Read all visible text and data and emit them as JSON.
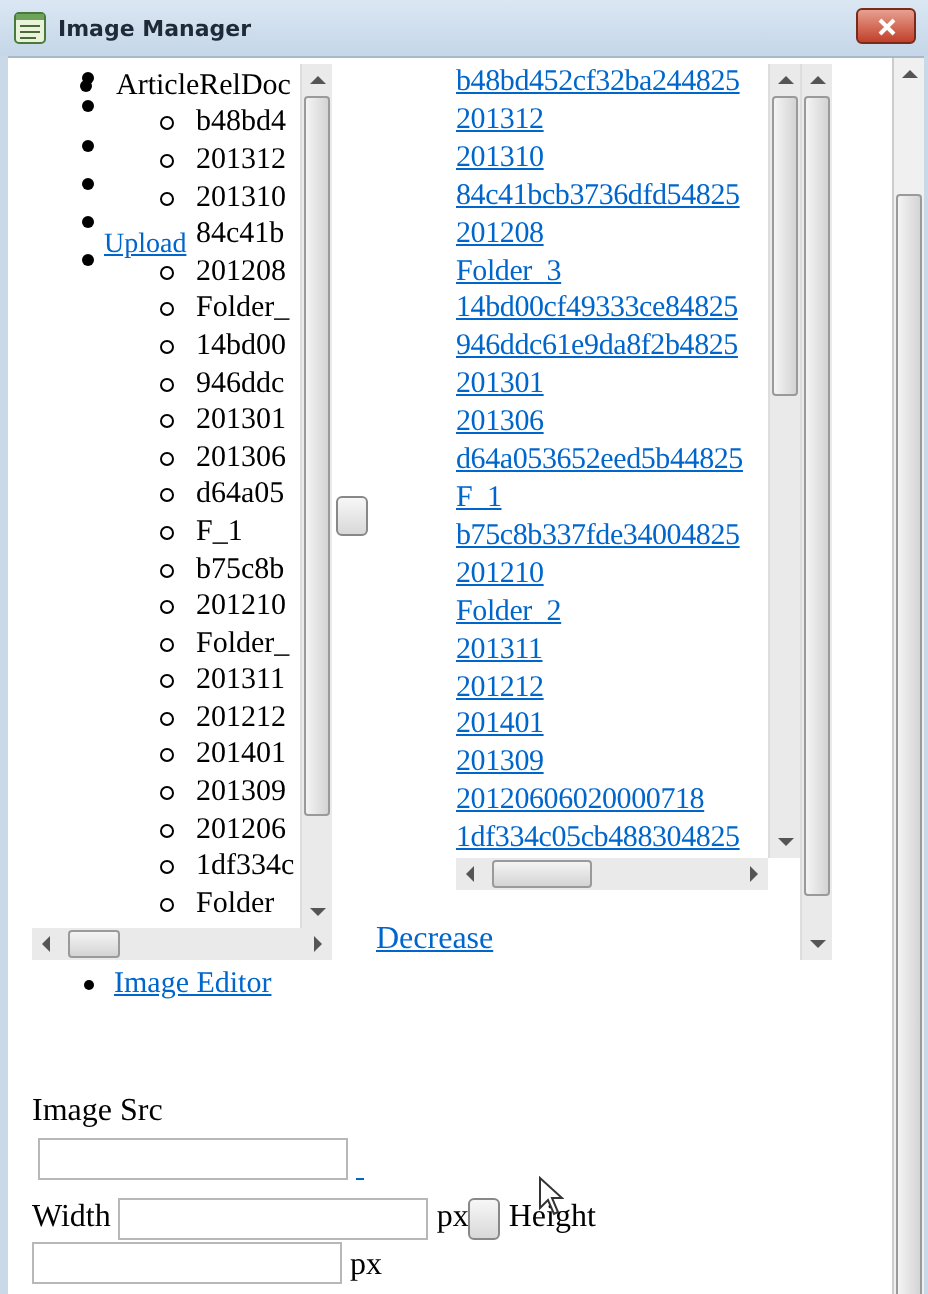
{
  "window": {
    "title": "Image Manager"
  },
  "tree": {
    "root": "ArticleRelDoc",
    "children": [
      "b48bd4",
      "201312",
      "201310",
      "84c41b",
      "201208",
      "Folder_",
      "14bd00",
      "946ddc",
      "201301",
      "201306",
      "d64a05",
      "F_1",
      "b75c8b",
      "201210",
      "Folder_",
      "201311",
      "201212",
      "201401",
      "201309",
      "201206",
      "1df334c",
      "Folder"
    ]
  },
  "upload_link": "Upload",
  "files": [
    "b48bd452cf32ba244825",
    "201312",
    "201310",
    "84c41bcb3736dfd54825",
    "201208",
    "Folder_3",
    "14bd00cf49333ce84825",
    "946ddc61e9da8f2b4825",
    "201301",
    "201306",
    "d64a053652eed5b44825",
    "F_1",
    "b75c8b337fde34004825",
    "201210",
    "Folder_2",
    "201311",
    "201212",
    "201401",
    "201309",
    "20120606020000718",
    "1df334c05cb488304825"
  ],
  "decrease_link": "Decrease",
  "image_editor_link": "Image Editor",
  "form": {
    "image_src_label": "Image Src",
    "width_label": "Width",
    "width_unit": "px",
    "height_label": "Height",
    "height_unit": "px"
  }
}
